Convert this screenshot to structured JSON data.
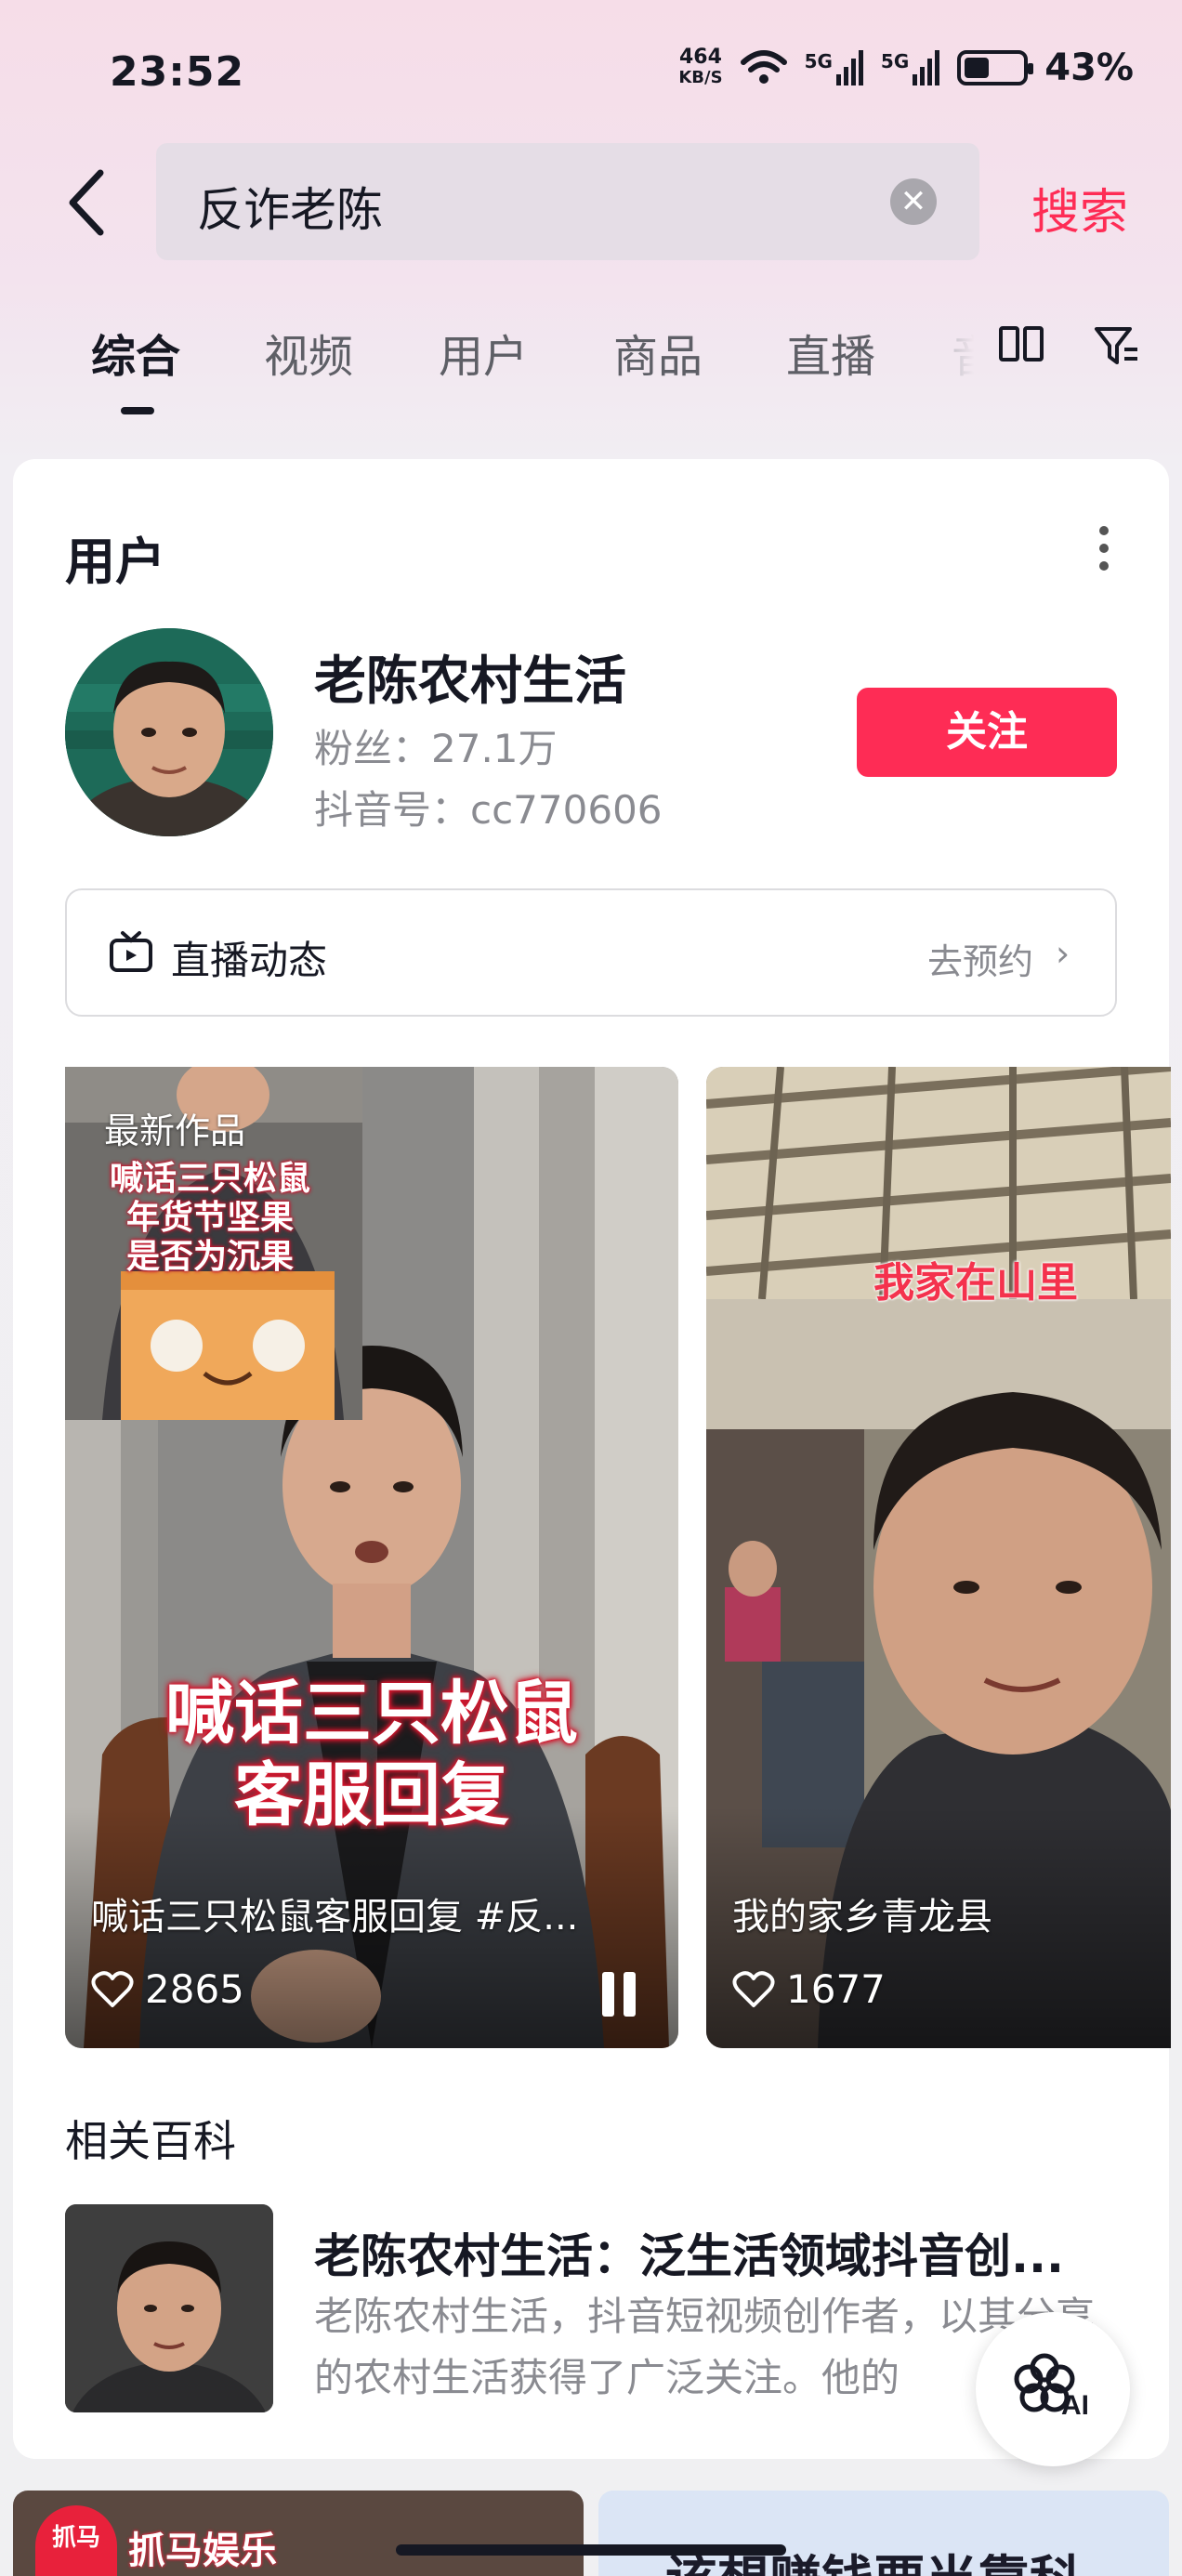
{
  "status_bar": {
    "time": "23:52",
    "net_speed_value": "464",
    "net_speed_unit": "KB/S",
    "signal1_label": "5G",
    "signal2_label": "5G",
    "battery_percent": "43%",
    "battery_level": 0.43
  },
  "search": {
    "query": "反诈老陈",
    "search_button": "搜索"
  },
  "tabs": [
    {
      "label": "综合",
      "active": true
    },
    {
      "label": "视频",
      "active": false
    },
    {
      "label": "用户",
      "active": false
    },
    {
      "label": "商品",
      "active": false
    },
    {
      "label": "直播",
      "active": false
    }
  ],
  "tab_overflow_partial": "音",
  "user_section": {
    "title": "用户",
    "name": "老陈农村生活",
    "fans": "粉丝：27.1万",
    "douyin_id": "抖音号：cc770606",
    "follow_button": "关注",
    "live_label": "直播动态",
    "live_action": "去预约"
  },
  "videos": [
    {
      "tag": "最新作品",
      "inset_caption": [
        "喊话三只松鼠",
        "年货节坚果",
        "是否为沉果"
      ],
      "overlay_caption": [
        "喊话三只松鼠",
        "客服回复"
      ],
      "title": "喊话三只松鼠客服回复 #反...",
      "likes": "2865"
    },
    {
      "overlay_caption": "我家在山里",
      "title": "我的家乡青龙县",
      "likes": "1677"
    }
  ],
  "wiki": {
    "section_title": "相关百科",
    "headline": "老陈农村生活：泛生活领域抖音创...",
    "description": "老陈农村生活，抖音短视频创作者，以其分享的农村生活获得了广泛关注。他的"
  },
  "ai_button": "AI",
  "bottom_tiles": {
    "left_brand_logo": "抓马",
    "left_brand_name": "抓马娱乐",
    "right_text": "该想赚钱要当靠科"
  },
  "colors": {
    "accent": "#fe2c55",
    "text_primary": "#161823",
    "text_secondary": "#8a8b91"
  }
}
